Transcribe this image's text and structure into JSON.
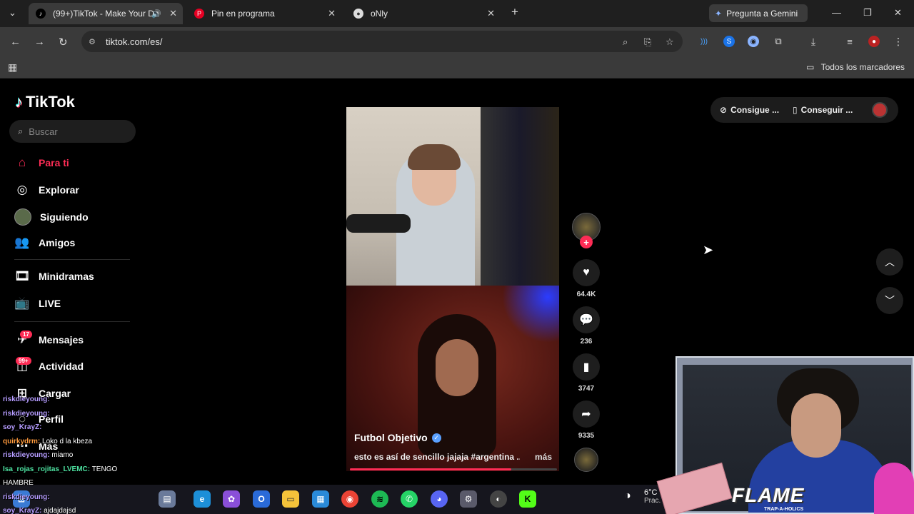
{
  "browser": {
    "tabs": [
      {
        "title": "(99+)TikTok - Make Your Da",
        "active": true
      },
      {
        "title": "Pin en programa",
        "active": false
      },
      {
        "title": "oNly",
        "active": false
      }
    ],
    "new_tab_label": "+",
    "gemini_label": "Pregunta a Gemini",
    "url": "tiktok.com/es/",
    "bookmarks_folder": "Todos los marcadores"
  },
  "tiktok": {
    "logo_text": "TikTok",
    "search_placeholder": "Buscar",
    "nav": [
      {
        "label": "Para ti",
        "icon": "home-icon"
      },
      {
        "label": "Explorar",
        "icon": "compass-icon"
      },
      {
        "label": "Siguiendo",
        "icon": "following-icon"
      },
      {
        "label": "Amigos",
        "icon": "friends-icon"
      },
      {
        "label": "Minidramas",
        "icon": "film-icon"
      },
      {
        "label": "LIVE",
        "icon": "live-icon"
      },
      {
        "label": "Mensajes",
        "icon": "messages-icon",
        "badge": "17"
      },
      {
        "label": "Actividad",
        "icon": "activity-icon",
        "badge": "99+"
      },
      {
        "label": "Cargar",
        "icon": "upload-icon"
      },
      {
        "label": "Perfil",
        "icon": "profile-icon"
      },
      {
        "label": "Más",
        "icon": "more-icon"
      }
    ],
    "top_right": {
      "coins_label": "Consigue ...",
      "app_label": "Conseguir ..."
    },
    "video": {
      "author": "Futbol Objetivo",
      "description": "esto es así de sencillo jajaja #argentina ...",
      "more_label": "más",
      "progress": 0.78
    },
    "actions": {
      "likes": "64.4K",
      "comments": "236",
      "saves": "3747",
      "shares": "9335"
    }
  },
  "stream": {
    "overlay_title": "FLAME",
    "overlay_subtitle": "TRAP-A-HOLICS",
    "chat": [
      {
        "user": "riskdieyoung:",
        "msg": "",
        "color": "#b59cff"
      },
      {
        "user": "riskdieyoung:",
        "msg": "",
        "color": "#b59cff"
      },
      {
        "user": "soy_KrayZ:",
        "msg": "",
        "color": "#b59cff"
      },
      {
        "user": "quirkydrm:",
        "msg": "Loko d la kbeza",
        "color": "#ff9a3c"
      },
      {
        "user": "riskdieyoung:",
        "msg": "miamo",
        "color": "#b59cff"
      },
      {
        "user": "Isa_rojas_rojitas_LVEMC:",
        "msg": "TENGO",
        "color": "#4de1a0"
      },
      {
        "user": "",
        "msg": "HAMBRE",
        "color": "#ffffff"
      },
      {
        "user": "riskdieyoung:",
        "msg": "",
        "color": "#b59cff"
      },
      {
        "user": "soy_KrayZ:",
        "msg": "ajdajdajsd",
        "color": "#b59cff"
      }
    ]
  },
  "taskbar": {
    "weather_temp": "6°C",
    "weather_desc": "Prac. des"
  },
  "colors": {
    "accent": "#fe2c55",
    "page_bg": "#000000",
    "chrome_bg": "#3a3a3a"
  }
}
